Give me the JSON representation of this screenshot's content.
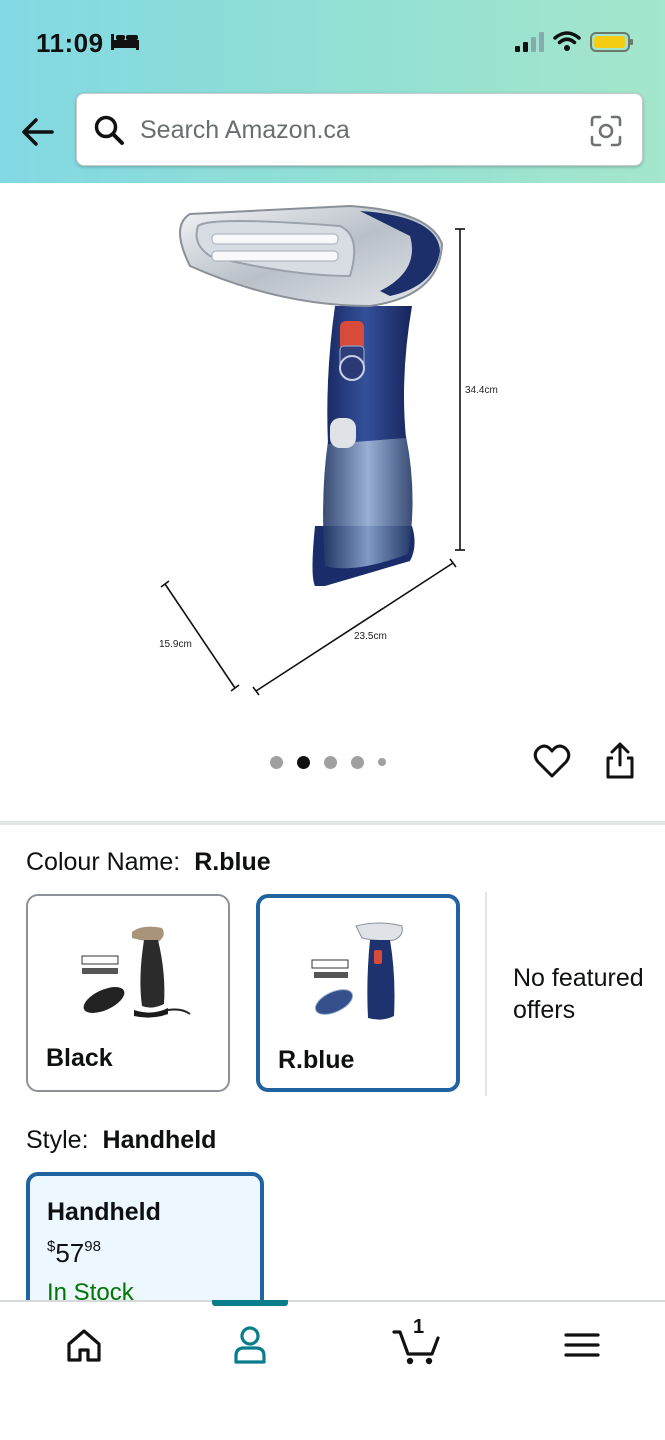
{
  "status_bar": {
    "time": "11:09"
  },
  "search": {
    "placeholder": "Search Amazon.ca"
  },
  "product_image": {
    "dimensions": {
      "height": "34.4cm",
      "depth": "15.9cm",
      "width": "23.5cm"
    },
    "carousel": {
      "count": 5,
      "active_index": 1
    }
  },
  "colour": {
    "label": "Colour Name:",
    "selected": "R.blue",
    "options": [
      {
        "label": "Black"
      },
      {
        "label": "R.blue"
      }
    ],
    "no_offers_text": "No featured offers"
  },
  "style": {
    "label": "Style:",
    "selected": "Handheld",
    "card": {
      "name": "Handheld",
      "price_symbol": "$",
      "price_whole": "57",
      "price_cents": "98",
      "stock": "In Stock"
    }
  },
  "bottom_nav": {
    "items": [
      "home-icon",
      "account-icon",
      "cart-icon",
      "menu-icon"
    ],
    "active": "account-icon",
    "cart_count": "1"
  },
  "colors": {
    "accent": "#2162a1",
    "teal": "#0a7d8c",
    "in_stock": "#007600"
  }
}
